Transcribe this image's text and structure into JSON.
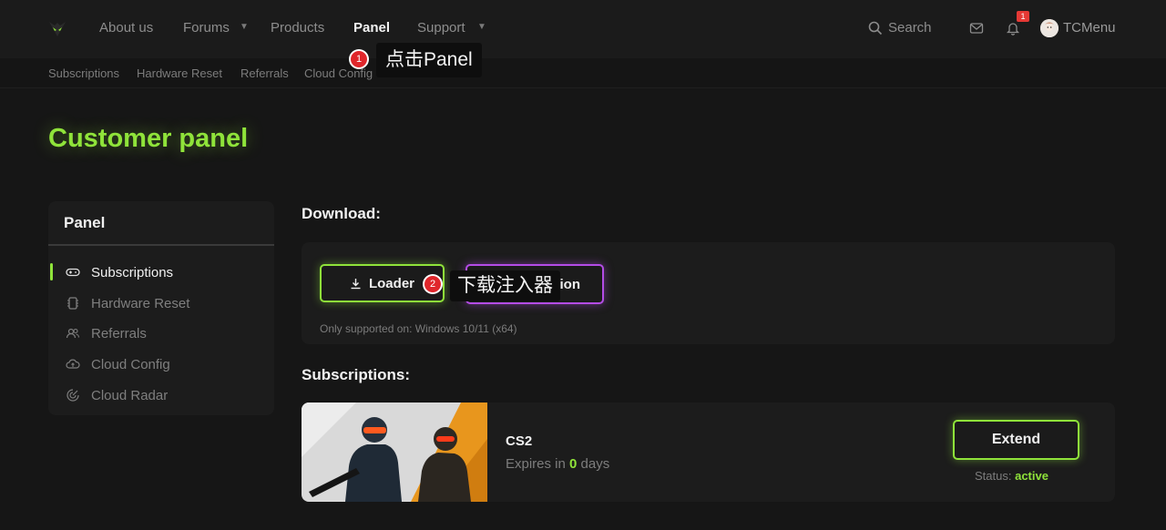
{
  "topnav": {
    "items": [
      {
        "label": "About us"
      },
      {
        "label": "Forums"
      },
      {
        "label": "Products"
      },
      {
        "label": "Panel"
      },
      {
        "label": "Support"
      }
    ],
    "search_label": "Search",
    "notification_count": "1",
    "username": "TCMenu"
  },
  "subnav": {
    "items": [
      {
        "label": "Subscriptions"
      },
      {
        "label": "Hardware Reset"
      },
      {
        "label": "Referrals"
      },
      {
        "label": "Cloud Config"
      },
      {
        "label": "Cloud Radar"
      }
    ]
  },
  "annotations": [
    {
      "number": "1",
      "text": "点击Panel"
    },
    {
      "number": "2",
      "text": "下载注入器"
    }
  ],
  "page": {
    "title": "Customer panel"
  },
  "sidebar": {
    "heading": "Panel",
    "items": [
      {
        "label": "Subscriptions",
        "icon": "gamepad-icon",
        "active": true
      },
      {
        "label": "Hardware Reset",
        "icon": "chip-icon",
        "active": false
      },
      {
        "label": "Referrals",
        "icon": "users-icon",
        "active": false
      },
      {
        "label": "Cloud Config",
        "icon": "cloud-upload-icon",
        "active": false
      },
      {
        "label": "Cloud Radar",
        "icon": "radar-icon",
        "active": false
      }
    ]
  },
  "download": {
    "heading": "Download:",
    "loader_label": "Loader",
    "injection_label": "ction",
    "supported_text": "Only supported on: Windows 10/11 (x64)"
  },
  "subscriptions": {
    "heading": "Subscriptions:",
    "items": [
      {
        "game": "CS2",
        "expires_prefix": "Expires in",
        "expires_days": "0",
        "expires_suffix": "days",
        "extend_label": "Extend",
        "status_label": "Status:",
        "status_value": "active"
      }
    ]
  },
  "colors": {
    "accent_green": "#8fe33a",
    "accent_purple": "#b44ce6",
    "annotation_red": "#e0262b",
    "background": "#161616"
  }
}
